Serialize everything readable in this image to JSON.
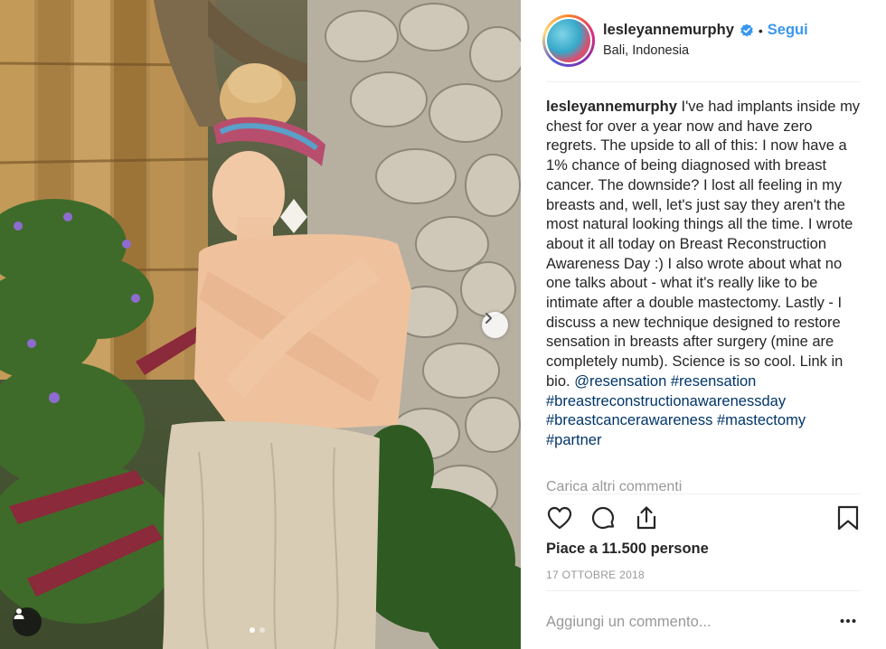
{
  "post": {
    "username": "lesleyannemurphy",
    "location": "Bali, Indonesia",
    "follow_label": "Segui",
    "separator": "•",
    "caption_text": "I've had implants inside my chest for over a year now and have zero regrets. The upside to all of this: I now have a 1% chance of being diagnosed with breast cancer. The downside? I lost all feeling in my breasts and, well, let's just say they aren't the most natural looking things all the time. I wrote about it all today on Breast Reconstruction Awareness Day :) I also wrote about what no one talks about - what it's really like to be intimate after a double mastectomy. Lastly - I discuss a new technique designed to restore sensation in breasts after surgery (mine are completely numb). Science is so cool. Link in bio.",
    "tags": [
      "@resensation",
      "#resensation",
      "#breastreconstructionawarenessday",
      "#breastcancerawareness",
      "#mastectomy",
      "#partner"
    ],
    "load_more_label": "Carica altri commenti",
    "likes_label": "Piace a 11.500 persone",
    "date_label": "17 OTTOBRE 2018",
    "comment_placeholder": "Aggiungi un commento..."
  },
  "carousel": {
    "dots_count": 2,
    "active_index": 0
  },
  "icons": {
    "verified": "verified-badge-icon",
    "like": "heart-icon",
    "comment": "comment-bubble-icon",
    "share": "share-upload-icon",
    "save": "bookmark-icon",
    "next": "chevron-right-icon",
    "tag": "user-tag-icon",
    "more": "more-options-icon"
  },
  "colors": {
    "link_blue": "#3897f0",
    "hashtag": "#003569",
    "muted": "#999999",
    "text": "#262626"
  }
}
